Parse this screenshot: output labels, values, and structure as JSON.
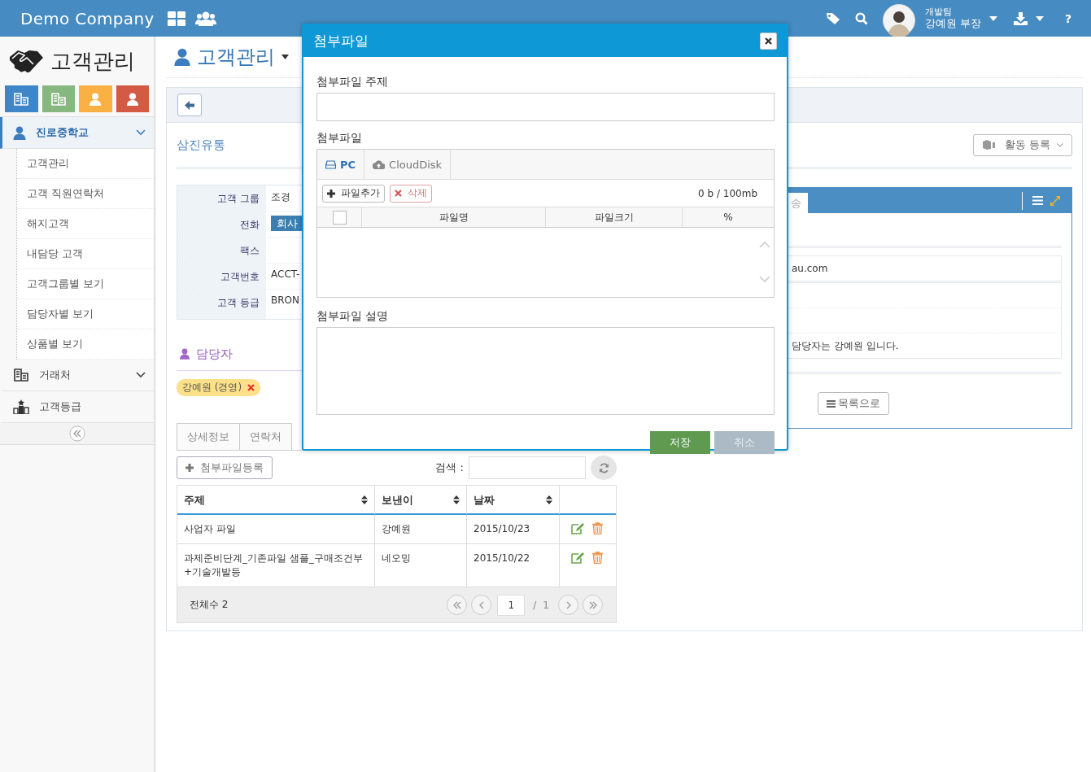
{
  "topbar": {
    "brand": "Demo Company",
    "user_team": "개발팀",
    "user_name": "강예원 부장",
    "help": "?"
  },
  "sidebar": {
    "title": "고객관리",
    "quick_buttons": [
      {
        "kind": "building",
        "color": "#3e86c8"
      },
      {
        "kind": "building",
        "color": "#86b77f"
      },
      {
        "kind": "person",
        "color": "#fbb044"
      },
      {
        "kind": "person",
        "color": "#d35a45"
      }
    ],
    "menu": [
      {
        "label": "진로중학교",
        "kind": "person",
        "selected": true,
        "children": [
          {
            "label": "고객관리"
          },
          {
            "label": "고객 직원연락처"
          },
          {
            "label": "해지고객"
          },
          {
            "label": "내담당 고객"
          },
          {
            "label": "고객그룹별 보기"
          },
          {
            "label": "담당자별 보기"
          },
          {
            "label": "상품별 보기"
          }
        ]
      },
      {
        "label": "거래처",
        "kind": "building",
        "selected": false
      },
      {
        "label": "고객등급",
        "kind": "ranking",
        "selected": false
      }
    ]
  },
  "page": {
    "title": "고객관리",
    "company": "삼진유통",
    "activity_button": "활동 등록",
    "info": [
      {
        "label": "고객 그룹",
        "kind": "text",
        "value": "조경"
      },
      {
        "label": "전화",
        "kind": "badge",
        "value": "회사"
      },
      {
        "label": "팩스"
      },
      {
        "label": "고객번호",
        "kind": "text",
        "value": "ACCT-"
      },
      {
        "label": "고객 등급",
        "kind": "text",
        "value": "BRON"
      }
    ],
    "manager_heading": "담당자",
    "manager_tags": [
      "강예원 (경영)"
    ],
    "tabs": [
      {
        "label": "상세정보",
        "selected": false
      },
      {
        "label": "연락처",
        "selected": false
      }
    ],
    "attach_button": "첨부파일등록",
    "search_label": "검색 :",
    "table": {
      "columns": [
        "주제",
        "보낸이",
        "날짜"
      ],
      "rows": [
        {
          "subject": "사업자 파일",
          "sender": "강예원",
          "date": "2015/10/23"
        },
        {
          "subject": "과제준비단계_기존파일 샘플_구매조건부 +기술개발등",
          "sender": "네오밍",
          "date": "2015/10/22"
        }
      ],
      "total": "전체수 2",
      "page": "1",
      "separator": "/",
      "pages": "1"
    },
    "right_panel": {
      "tab_fragment": "송",
      "email_fragment": "au.com",
      "note": "담당자는 강예원 입니다.",
      "list_button": "목록으로"
    }
  },
  "modal": {
    "title": "첨부파일",
    "subject_label": "첨부파일 주제",
    "files_label": "첨부파일",
    "source_tabs": [
      {
        "label": "PC",
        "kind": "pc",
        "selected": true
      },
      {
        "label": "CloudDisk",
        "kind": "cloud",
        "selected": false
      }
    ],
    "add_button": "파일추가",
    "delete_button": "삭제",
    "quota": "0 b / 100mb",
    "select_all_checked": false,
    "columns": [
      "파일명",
      "파일크기",
      "%"
    ],
    "description_label": "첨부파일 설명",
    "save_button": "저장",
    "cancel_button": {
      "label": "취소",
      "disabled": true
    }
  }
}
